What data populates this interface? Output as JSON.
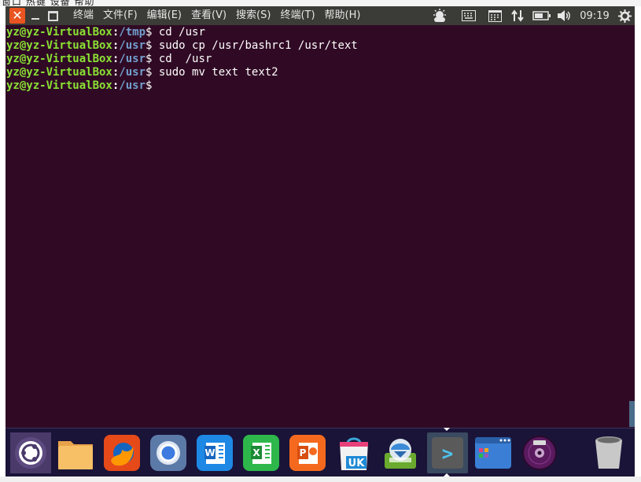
{
  "top_strip_text": "窗口 热键 设备 帮助",
  "window": {
    "close_label": "✕"
  },
  "menu": {
    "items": [
      "终端",
      "文件(F)",
      "编辑(E)",
      "查看(V)",
      "搜索(S)",
      "终端(T)",
      "帮助(H)"
    ]
  },
  "indicators": {
    "clock": "09:19",
    "icons": [
      "weather-icon",
      "keyboard-icon",
      "calendar-icon",
      "network-arrows-icon",
      "battery-icon",
      "volume-icon",
      "settings-gear-icon"
    ]
  },
  "terminal": {
    "lines": [
      {
        "user": "yz@yz-VirtualBox",
        "path": "/tmp",
        "symbol": "$",
        "cmd": " cd /usr"
      },
      {
        "user": "yz@yz-VirtualBox",
        "path": "/usr",
        "symbol": "$",
        "cmd": " sudo cp /usr/bashrc1 /usr/text"
      },
      {
        "user": "yz@yz-VirtualBox",
        "path": "/usr",
        "symbol": "$",
        "cmd": " cd  /usr"
      },
      {
        "user": "yz@yz-VirtualBox",
        "path": "/usr",
        "symbol": "$",
        "cmd": " sudo mv text text2"
      },
      {
        "user": "yz@yz-VirtualBox",
        "path": "/usr",
        "symbol": "$",
        "cmd": ""
      }
    ]
  },
  "dock": {
    "items": [
      {
        "name": "ubuntu-dash-icon"
      },
      {
        "name": "files-folder-icon"
      },
      {
        "name": "firefox-icon"
      },
      {
        "name": "chromium-icon"
      },
      {
        "name": "wps-writer-icon",
        "text": "W"
      },
      {
        "name": "wps-spreadsheets-icon",
        "text": "X"
      },
      {
        "name": "wps-presentation-icon",
        "text": "P"
      },
      {
        "name": "ubuntu-kylin-software-icon",
        "text": "UK"
      },
      {
        "name": "software-updater-icon"
      },
      {
        "name": "terminal-icon",
        "text": ">"
      },
      {
        "name": "window-manager-icon"
      },
      {
        "name": "dvd-disc-icon"
      },
      {
        "name": "trash-icon"
      }
    ]
  },
  "colors": {
    "terminal_bg": "#300a24",
    "prompt_user": "#8ae234",
    "prompt_path": "#729fcf",
    "close_button": "#e95420",
    "topbar_bg": "#3b3b37",
    "dock_bg": "#1a1438"
  }
}
